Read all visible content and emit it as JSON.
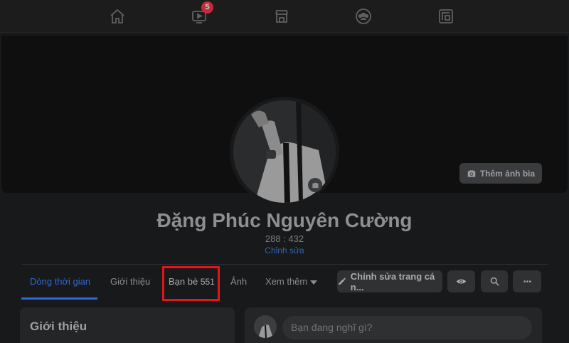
{
  "nav": {
    "items": [
      {
        "icon": "home-icon"
      },
      {
        "icon": "watch-icon",
        "badge": "5"
      },
      {
        "icon": "marketplace-icon"
      },
      {
        "icon": "groups-icon"
      },
      {
        "icon": "gaming-icon"
      }
    ]
  },
  "cover": {
    "add_cover_label": "Thêm ảnh bìa"
  },
  "profile": {
    "name": "Đặng Phúc Nguyên Cường",
    "ratio": "288 : 432",
    "edit_label": "Chỉnh sửa"
  },
  "tabs": {
    "timeline": "Dòng thời gian",
    "about": "Giới thiệu",
    "friends": "Bạn bè",
    "friends_count": "551",
    "photos": "Ảnh",
    "more": "Xem thêm"
  },
  "actions": {
    "edit_profile": "Chỉnh sửa trang cá n..."
  },
  "intro": {
    "title": "Giới thiệu"
  },
  "composer": {
    "placeholder": "Bạn đang nghĩ gì?"
  },
  "colors": {
    "accent": "#2d6ad1",
    "highlight": "#e0161e",
    "badge": "#c42b3a"
  }
}
